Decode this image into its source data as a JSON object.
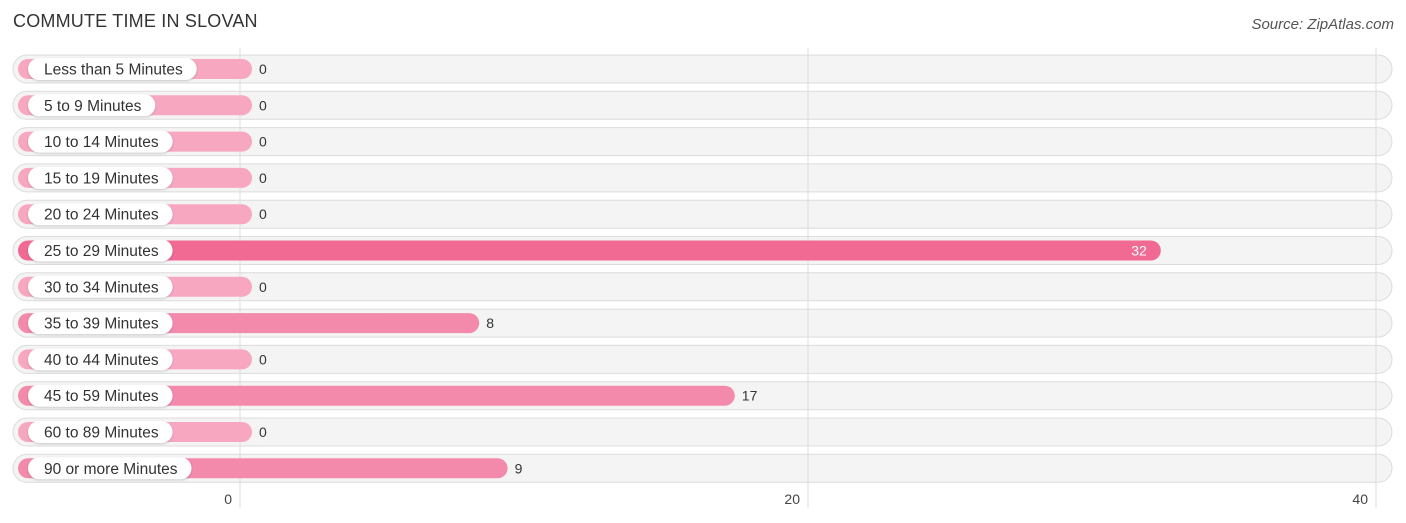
{
  "header": {
    "title": "COMMUTE TIME IN SLOVAN",
    "source": "Source: ZipAtlas.com"
  },
  "colors": {
    "bar_light": "#f7a8c0",
    "bar_highlight": "#f06a94",
    "bar_mid": "#f48aab",
    "row_bg": "#f4f4f4",
    "label_text": "#333333",
    "value_text_outside": "#333333",
    "value_text_inside": "#ffffff"
  },
  "chart_data": {
    "type": "bar",
    "orientation": "horizontal",
    "title": "COMMUTE TIME IN SLOVAN",
    "xlabel": "",
    "ylabel": "",
    "xlim": [
      0,
      40
    ],
    "xticks": [
      0,
      20,
      40
    ],
    "grid": true,
    "categories": [
      "Less than 5 Minutes",
      "5 to 9 Minutes",
      "10 to 14 Minutes",
      "15 to 19 Minutes",
      "20 to 24 Minutes",
      "25 to 29 Minutes",
      "30 to 34 Minutes",
      "35 to 39 Minutes",
      "40 to 44 Minutes",
      "45 to 59 Minutes",
      "60 to 89 Minutes",
      "90 or more Minutes"
    ],
    "values": [
      0,
      0,
      0,
      0,
      0,
      32,
      0,
      8,
      0,
      17,
      0,
      9
    ],
    "value_labels": [
      "0",
      "0",
      "0",
      "0",
      "0",
      "32",
      "0",
      "8",
      "0",
      "17",
      "0",
      "9"
    ],
    "highlight_index": 5
  }
}
